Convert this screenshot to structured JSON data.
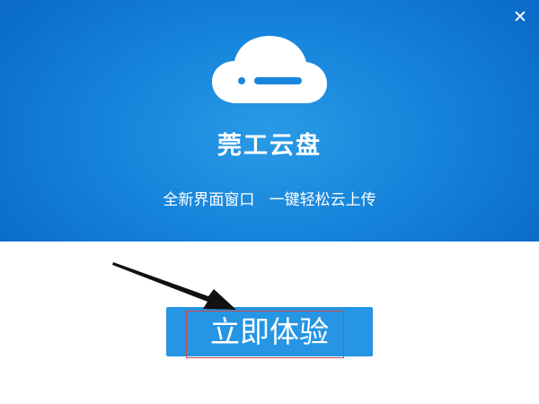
{
  "window": {
    "close_icon": "close-icon",
    "close_glyph": "✕"
  },
  "banner": {
    "logo_icon": "cloud-icon",
    "title": "莞工云盘",
    "subtitle": "全新界面窗口   一键轻松云上传"
  },
  "main": {
    "cta_label": "立即体验"
  },
  "colors": {
    "banner_blue": "#1786dc",
    "button_blue": "#2595e4",
    "highlight_red": "#d24848"
  }
}
